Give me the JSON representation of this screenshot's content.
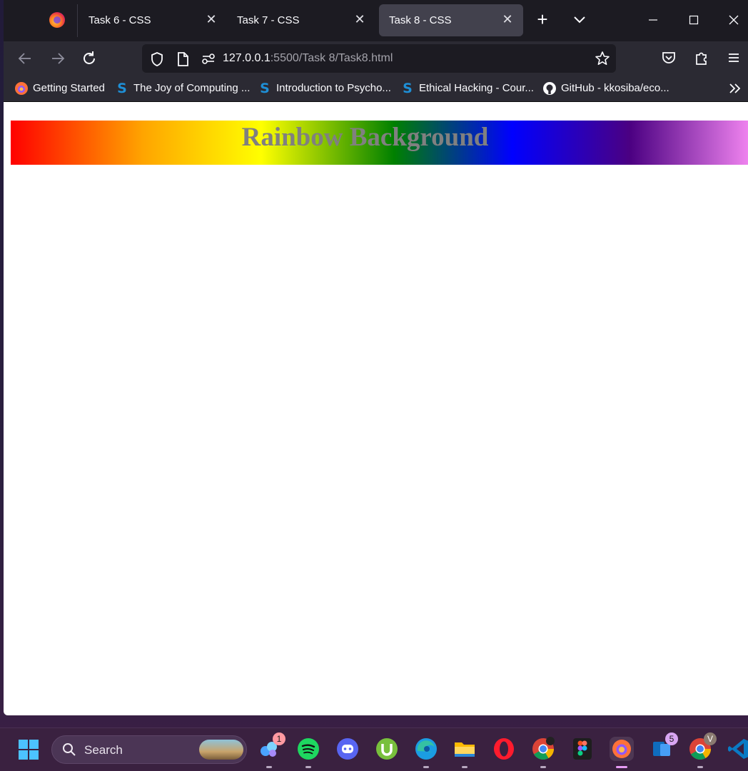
{
  "tabs": [
    {
      "title": "Task 6 - CSS",
      "active": false
    },
    {
      "title": "Task 7 - CSS",
      "active": false
    },
    {
      "title": "Task 8 - CSS",
      "active": true
    }
  ],
  "toolbar": {
    "new_tab": "+",
    "url_host": "127.0.0.1",
    "url_path": ":5500/Task 8/Task8.html"
  },
  "bookmarks": [
    {
      "label": "Getting Started",
      "icon": "firefox-icon"
    },
    {
      "label": "The Joy of Computing ...",
      "icon": "swayam-icon"
    },
    {
      "label": "Introduction to Psycho...",
      "icon": "swayam-icon"
    },
    {
      "label": "Ethical Hacking - Cour...",
      "icon": "swayam-icon"
    },
    {
      "label": "GitHub - kkosiba/eco...",
      "icon": "github-icon"
    }
  ],
  "page": {
    "heading": "Rainbow Background",
    "heading_color": "#808080",
    "gradient_colors": [
      "#ff0000",
      "#ffa500",
      "#ffff00",
      "#008000",
      "#0000ff",
      "#4b0082",
      "#ee82ee"
    ]
  },
  "taskbar": {
    "search_label": "Search",
    "apps": [
      {
        "name": "copilot-icon",
        "badge": "1"
      },
      {
        "name": "spotify-icon",
        "badge": ""
      },
      {
        "name": "discord-icon",
        "badge": ""
      },
      {
        "name": "utorrent-icon",
        "badge": ""
      },
      {
        "name": "edge-icon",
        "badge": ""
      },
      {
        "name": "file-explorer-icon",
        "badge": ""
      },
      {
        "name": "opera-icon",
        "badge": ""
      },
      {
        "name": "chrome-icon",
        "badge": ""
      },
      {
        "name": "figma-icon",
        "badge": ""
      },
      {
        "name": "firefox-icon",
        "badge": ""
      },
      {
        "name": "teams-icon",
        "badge": "5"
      },
      {
        "name": "chrome-profile-icon",
        "badge": "V"
      },
      {
        "name": "vscode-icon",
        "badge": ""
      }
    ]
  },
  "colors": {
    "accent_active_tab": "#42414d",
    "toolbar_bg": "#2b2a33",
    "taskbar_bg": "#3a2140"
  }
}
